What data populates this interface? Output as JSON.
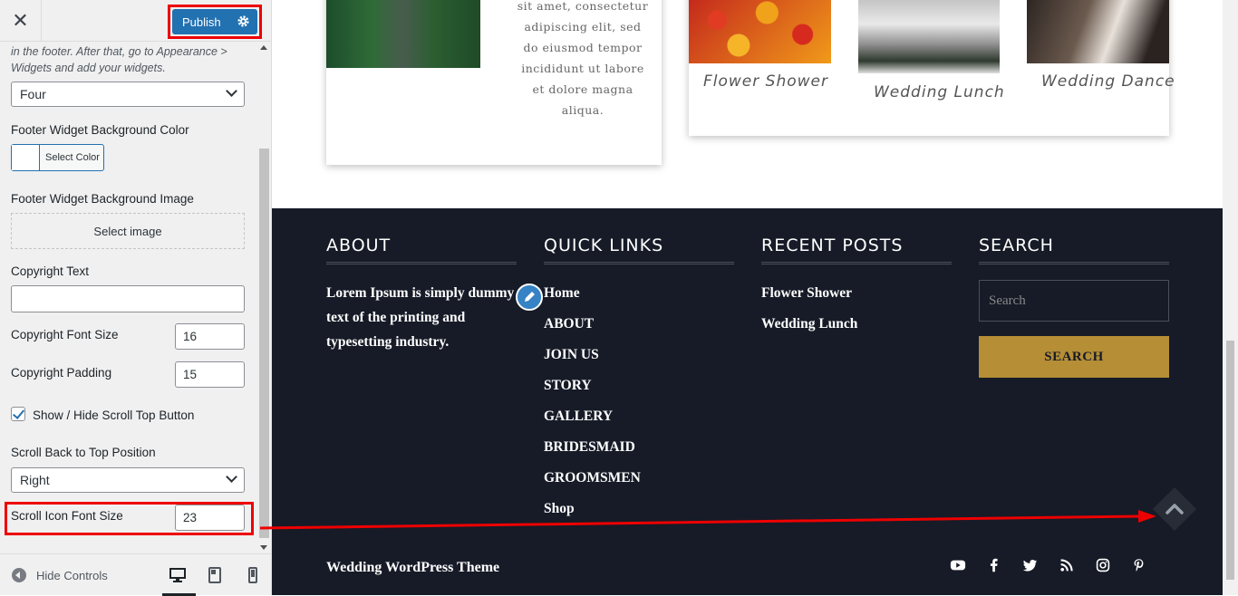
{
  "header": {
    "close_label": "✕",
    "publish_label": "Publish"
  },
  "controls": {
    "widgets_description": "in the footer. After that, go to Appearance > Widgets and add your widgets.",
    "widget_columns_value": "Four",
    "bg_color_label": "Footer Widget Background Color",
    "select_color_label": "Select Color",
    "bg_image_label": "Footer Widget Background Image",
    "select_image_label": "Select image",
    "copyright_text_label": "Copyright Text",
    "copyright_text_value": "",
    "copyright_font_size_label": "Copyright Font Size",
    "copyright_font_size_value": "16",
    "copyright_padding_label": "Copyright Padding",
    "copyright_padding_value": "15",
    "scroll_top_toggle_label": "Show / Hide Scroll Top Button",
    "scroll_top_position_label": "Scroll Back to Top Position",
    "scroll_top_position_value": "Right",
    "scroll_icon_size_label": "Scroll Icon Font Size",
    "scroll_icon_size_value": "23"
  },
  "footer_bar": {
    "hide_controls_label": "Hide Controls"
  },
  "preview": {
    "card_text": "sit amet, consectetur adipiscing elit, sed do eiusmod tempor incididunt ut labore et dolore magna aliqua.",
    "gallery": [
      {
        "caption": "Flower Shower"
      },
      {
        "caption": "Wedding Lunch"
      },
      {
        "caption": "Wedding Dance"
      }
    ],
    "about": {
      "heading": "ABOUT",
      "text": "Lorem Ipsum is simply dummy text of the printing and typesetting industry."
    },
    "quick_links": {
      "heading": "QUICK LINKS",
      "items": [
        "Home",
        "ABOUT",
        "JOIN US",
        "STORY",
        "GALLERY",
        "BRIDESMAID",
        "GROOMSMEN",
        "Shop"
      ]
    },
    "recent_posts": {
      "heading": "RECENT POSTS",
      "items": [
        "Flower Shower",
        "Wedding Lunch"
      ]
    },
    "search": {
      "heading": "SEARCH",
      "placeholder": "Search",
      "button_label": "SEARCH"
    },
    "copyright": "Wedding WordPress Theme",
    "social_icons": [
      "youtube-icon",
      "facebook-icon",
      "twitter-icon",
      "rss-icon",
      "instagram-icon",
      "pinterest-icon"
    ]
  },
  "colors": {
    "publish_blue": "#2271b1",
    "highlight_red": "#ee0000",
    "footer_bg": "#161b27",
    "search_button": "#b58e36"
  }
}
